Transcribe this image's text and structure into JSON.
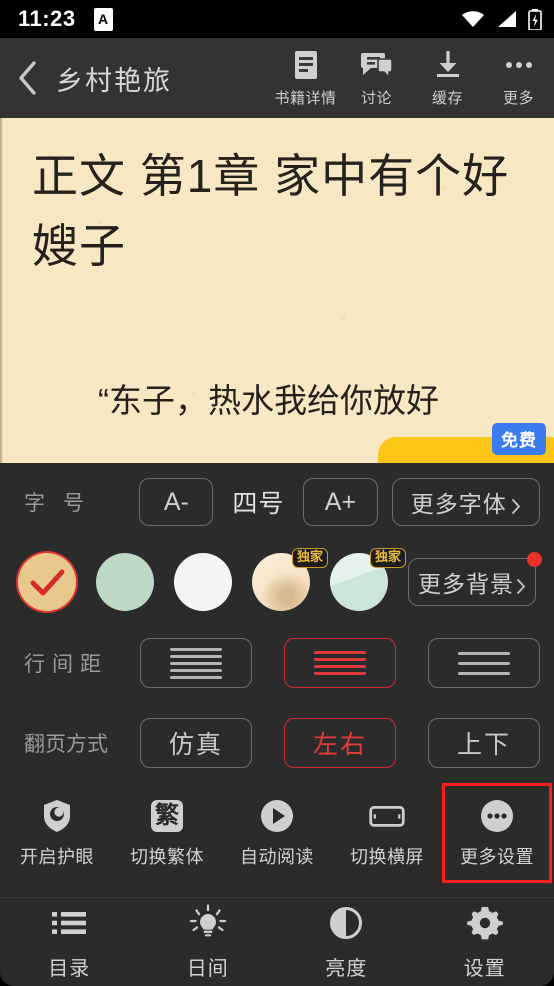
{
  "status_bar": {
    "time": "11:23",
    "notification_icon_letter": "A",
    "icons": [
      "wifi-icon",
      "signal-icon",
      "battery-charging-icon"
    ]
  },
  "top_bar": {
    "back_icon": "chevron-left-icon",
    "title": "乡村艳旅",
    "actions": [
      {
        "label": "书籍详情",
        "icon": "book-detail-icon"
      },
      {
        "label": "讨论",
        "icon": "comment-icon"
      },
      {
        "label": "缓存",
        "icon": "download-icon"
      },
      {
        "label": "更多",
        "icon": "more-horizontal-icon"
      }
    ]
  },
  "reader": {
    "chapter_title": "正文 第1章 家中有个好嫂子",
    "body_text": "“东子，热水我给你放好",
    "ad_badge": "免费",
    "page_background_color": "#f7e7c3",
    "ad_pill_color": "#fbc617",
    "badge_color": "#3a7bf0"
  },
  "panel": {
    "font_row": {
      "label": "字号",
      "decrease_label": "A-",
      "size_value": "四号",
      "increase_label": "A+",
      "more_fonts_label": "更多字体"
    },
    "background_row": {
      "more_backgrounds_label": "更多背景",
      "has_red_dot": true,
      "swatches": [
        {
          "name": "beige",
          "color": "#e9c88d",
          "selected": true,
          "exclusive": false
        },
        {
          "name": "mint-green",
          "color": "#bdd9c3",
          "selected": false,
          "exclusive": false
        },
        {
          "name": "white",
          "color": "#f5f5f7",
          "selected": false,
          "exclusive": false
        },
        {
          "name": "exclusive-tan-illustration",
          "color": "#f3ddc1",
          "selected": false,
          "exclusive": true,
          "badge": "独家"
        },
        {
          "name": "exclusive-green-illustration",
          "color": "#cfe5da",
          "selected": false,
          "exclusive": true,
          "badge": "独家"
        }
      ]
    },
    "line_spacing_row": {
      "label": "行间距",
      "options": [
        {
          "name": "tight",
          "lines": 5,
          "selected": false
        },
        {
          "name": "medium",
          "lines": 4,
          "selected": true
        },
        {
          "name": "loose",
          "lines": 3,
          "selected": false
        }
      ]
    },
    "page_turn_row": {
      "label": "翻页方式",
      "options": [
        {
          "label": "仿真",
          "selected": false
        },
        {
          "label": "左右",
          "selected": true
        },
        {
          "label": "上下",
          "selected": false
        }
      ]
    },
    "tools": [
      {
        "label": "开启护眼",
        "icon": "eye-shield-icon",
        "highlighted": false
      },
      {
        "label": "切换繁体",
        "icon": "traditional-chinese-icon",
        "glyph": "繁",
        "highlighted": false
      },
      {
        "label": "自动阅读",
        "icon": "play-circle-icon",
        "highlighted": false
      },
      {
        "label": "切换横屏",
        "icon": "landscape-screen-icon",
        "highlighted": false
      },
      {
        "label": "更多设置",
        "icon": "more-dots-circle-icon",
        "highlighted": true
      }
    ],
    "accent_selected_color": "#e03b3b",
    "highlight_box_color": "#ff1c1c"
  },
  "bottom_nav": [
    {
      "label": "目录",
      "icon": "list-icon"
    },
    {
      "label": "日间",
      "icon": "sun-brightness-icon"
    },
    {
      "label": "亮度",
      "icon": "contrast-circle-icon"
    },
    {
      "label": "设置",
      "icon": "gear-icon"
    }
  ]
}
